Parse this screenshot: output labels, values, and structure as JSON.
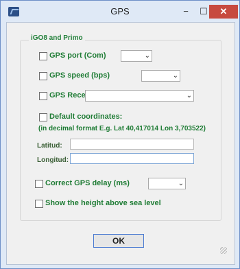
{
  "window": {
    "title": "GPS",
    "minimize_glyph": "−",
    "maximize_glyph": "☐",
    "close_glyph": "✕"
  },
  "group": {
    "label": "iGO8 and Primo"
  },
  "gps_port": {
    "label": "GPS port (Com)",
    "value": "",
    "icon": "chevron-down-icon"
  },
  "gps_speed": {
    "label": "GPS speed (bps)",
    "value": "",
    "icon": "chevron-down-icon"
  },
  "gps_receiver": {
    "label": "GPS Receiver",
    "value": "",
    "icon": "chevron-down-icon"
  },
  "default_coordinates": {
    "label": "Default coordinates:",
    "hint": "(in decimal format E.g. Lat 40,417014 Lon 3,703522)",
    "latitude_label": "Latitud:",
    "latitude_value": "",
    "longitude_label": "Longitud:",
    "longitude_value": ""
  },
  "correct_delay": {
    "label": "Correct GPS delay (ms)",
    "value": "",
    "icon": "chevron-down-icon"
  },
  "show_height": {
    "label": "Show the height above sea level"
  },
  "ok_button": {
    "label": "OK"
  },
  "colors": {
    "label_green": "#1f7c35",
    "close_red": "#c74a3f",
    "frame_blue": "#dfe9f6"
  }
}
